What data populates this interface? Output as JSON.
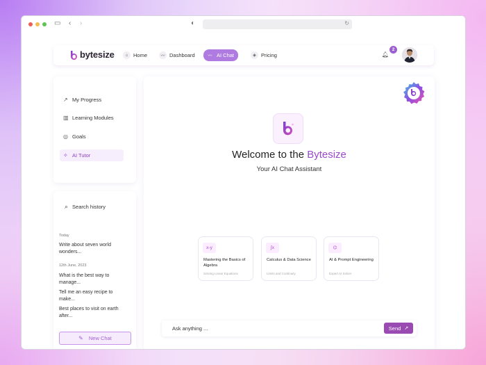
{
  "colors": {
    "accent": "#b07be0",
    "brand_text": "#9a49cc",
    "send_button": "#9a4bb2"
  },
  "navbar": {
    "brand": "bytesize",
    "items": [
      {
        "label": "Home",
        "icon": "home-icon"
      },
      {
        "label": "Dashboard",
        "icon": "trend-icon"
      },
      {
        "label": "AI Chat",
        "icon": "trend-icon"
      },
      {
        "label": "Pricing",
        "icon": "tag-icon"
      }
    ],
    "notification_count": "2"
  },
  "sidebar": {
    "items": [
      {
        "label": "My Progress",
        "icon": "chart-icon"
      },
      {
        "label": "Learning Modules",
        "icon": "book-icon"
      },
      {
        "label": "Goals",
        "icon": "target-icon"
      },
      {
        "label": "AI Tutor",
        "icon": "sparkle-icon"
      }
    ]
  },
  "history": {
    "search_label": "Search history",
    "groups": [
      {
        "label": "Today",
        "items": [
          "Write about seven world wonders..."
        ]
      },
      {
        "label": "12th June, 2023",
        "items": [
          "What is the best way to manage...",
          "Tell me an easy recipe to make...",
          "Best places to visit on earth after..."
        ]
      }
    ],
    "new_chat": "New Chat"
  },
  "main": {
    "welcome_prefix": "Welcome to the ",
    "welcome_brand": "Bytesize",
    "subtitle": "Your AI Chat Assistant",
    "suggestions": [
      {
        "icon_text": "x-y",
        "title": "Mastering the Basics of Algebra",
        "sub": "Solving Linear Equations"
      },
      {
        "icon_text": "∫x",
        "title": "Calculus & Data Science",
        "sub": "Limits and Continuity"
      },
      {
        "icon_text": "⌬",
        "title": "AI & Prompt Engineering",
        "sub": "Expert AI Solver"
      }
    ],
    "input_placeholder": "Ask anything ...",
    "send_label": "Send"
  }
}
